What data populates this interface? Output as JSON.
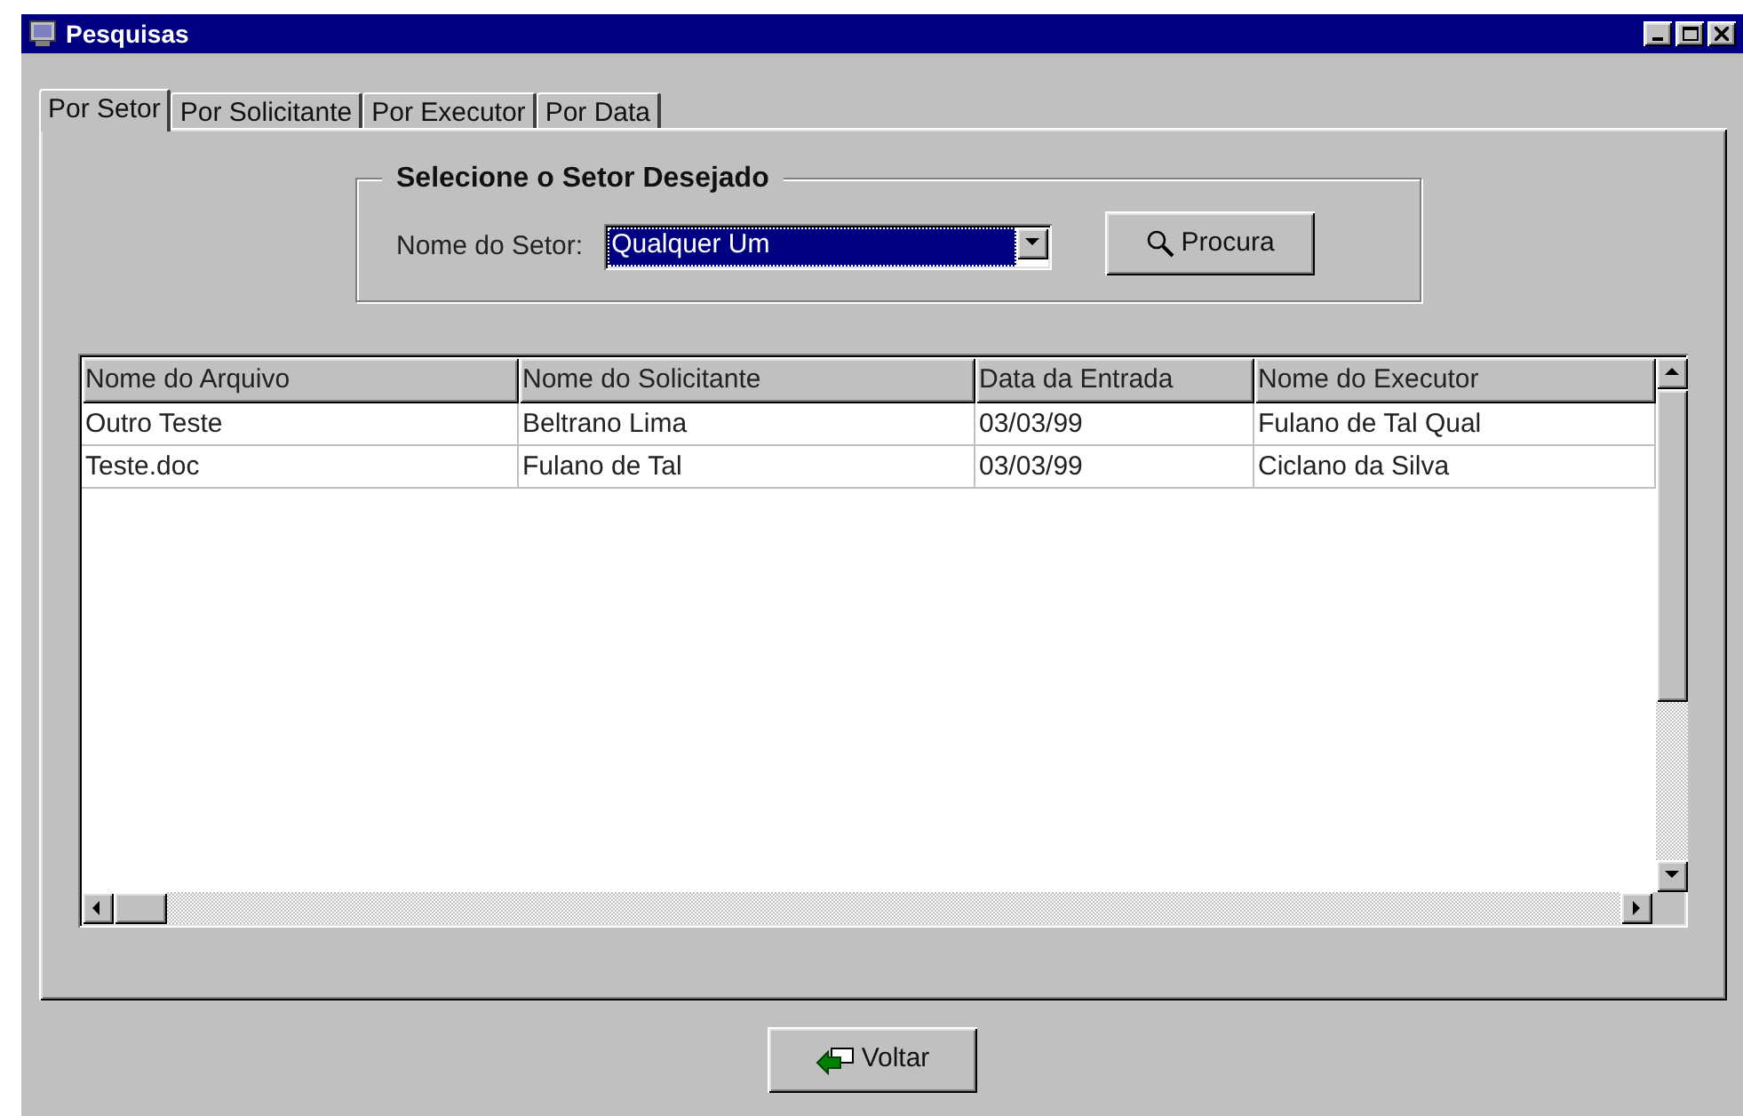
{
  "window": {
    "title": "Pesquisas"
  },
  "tabs": [
    {
      "label": "Por Setor",
      "selected": true
    },
    {
      "label": "Por Solicitante",
      "selected": false
    },
    {
      "label": "Por Executor",
      "selected": false
    },
    {
      "label": "Por Data",
      "selected": false
    }
  ],
  "group": {
    "title": "Selecione o Setor Desejado",
    "field_label": "Nome do Setor:",
    "dropdown_value": "Qualquer Um",
    "search_button": "Procura"
  },
  "table": {
    "columns": [
      "Nome do Arquivo",
      "Nome do Solicitante",
      "Data da Entrada",
      "Nome do Executor"
    ],
    "rows": [
      [
        "Outro Teste",
        "Beltrano Lima",
        "03/03/99",
        "Fulano de Tal Qual"
      ],
      [
        "Teste.doc",
        "Fulano de Tal",
        "03/03/99",
        "Ciclano da Silva"
      ]
    ]
  },
  "back_button": "Voltar"
}
